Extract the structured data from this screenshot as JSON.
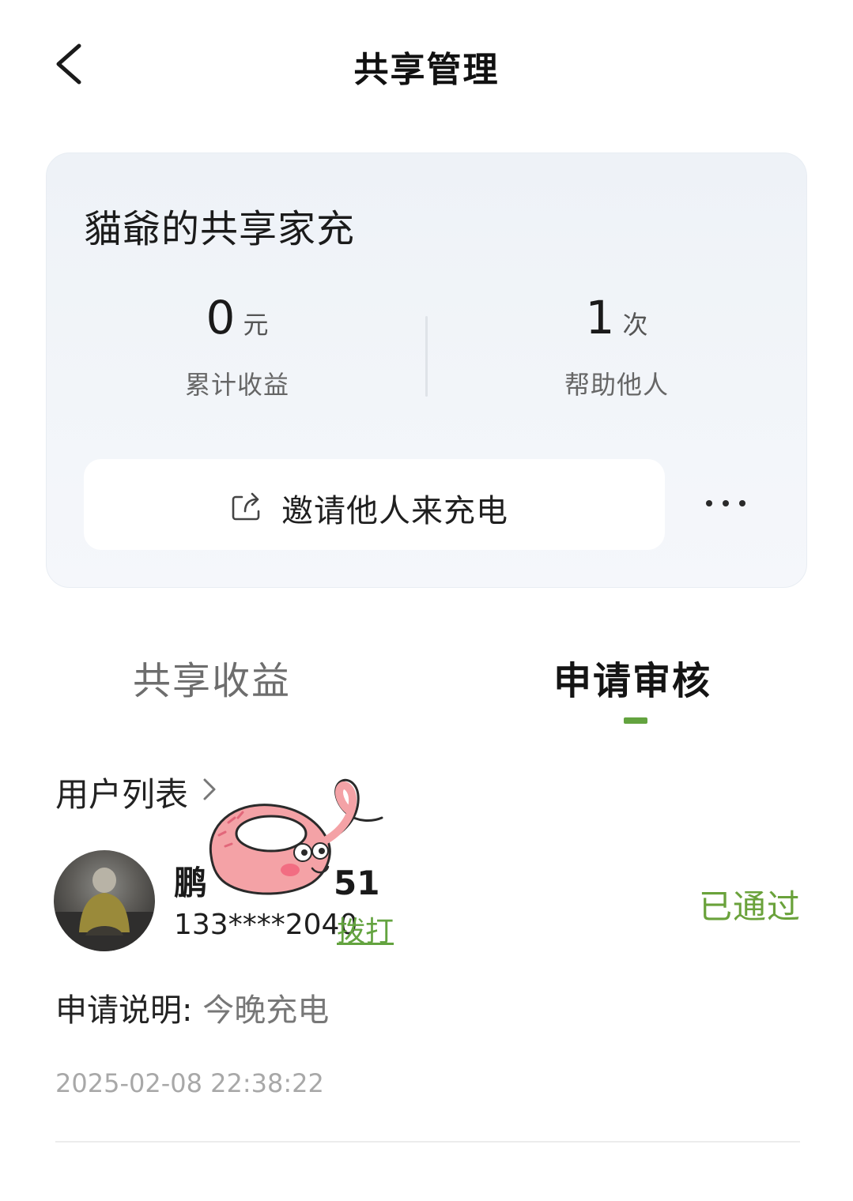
{
  "header": {
    "title": "共享管理",
    "back_icon": "chevron-left-icon"
  },
  "summary_card": {
    "title": "貓爺的共享家充",
    "earnings": {
      "value": "0",
      "unit": "元",
      "label": "累计收益"
    },
    "helped": {
      "value": "1",
      "unit": "次",
      "label": "帮助他人"
    },
    "invite_button": {
      "label": "邀请他人来充电",
      "icon": "share-icon"
    },
    "more_icon": "more-dots-icon"
  },
  "tabs": [
    {
      "label": "共享收益",
      "active": false
    },
    {
      "label": "申请审核",
      "active": true
    }
  ],
  "accent_color": "#63a33f",
  "user_list": {
    "label": "用户列表",
    "chevron_icon": "chevron-right-icon"
  },
  "application": {
    "name_visible_start": "鹏",
    "name_visible_end": "51",
    "phone": "133****2040",
    "call_label": "拨打",
    "status": "已通过",
    "note_key": "申请说明: ",
    "note_value": "今晚充电",
    "timestamp": "2025-02-08 22:38:22"
  }
}
